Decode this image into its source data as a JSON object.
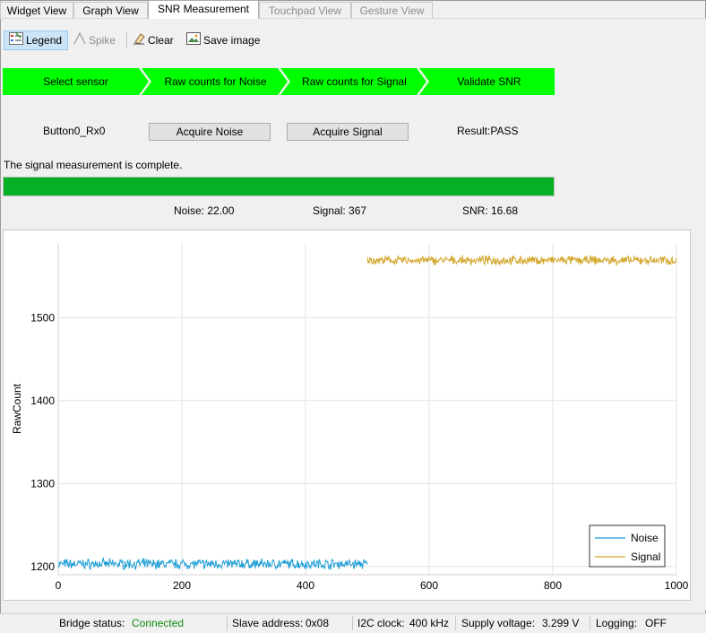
{
  "tabs": [
    {
      "label": "Widget View",
      "state": "normal"
    },
    {
      "label": "Graph View",
      "state": "normal"
    },
    {
      "label": "SNR Measurement",
      "state": "active"
    },
    {
      "label": "Touchpad View",
      "state": "disabled"
    },
    {
      "label": "Gesture View",
      "state": "disabled"
    }
  ],
  "toolbar": {
    "legend": "Legend",
    "spike": "Spike",
    "clear": "Clear",
    "save_image": "Save image"
  },
  "steps": [
    "Select sensor",
    "Raw counts for Noise",
    "Raw counts for Signal",
    "Validate SNR"
  ],
  "step_color": "#00ff00",
  "sensor": "Button0_Rx0",
  "buttons": {
    "acquire_noise": "Acquire Noise",
    "acquire_signal": "Acquire Signal"
  },
  "result": "Result:PASS",
  "status_message": "The signal measurement is complete.",
  "progress_percent": 100,
  "metrics": {
    "noise": "Noise:  22.00",
    "signal": "Signal:  367",
    "snr": "SNR:  16.68"
  },
  "chart_data": {
    "type": "line",
    "ylabel": "RawCount",
    "xlabel": "",
    "xlim": [
      0,
      1000
    ],
    "ylim": [
      1190,
      1590
    ],
    "x_ticks": [
      "0",
      "200",
      "400",
      "600",
      "800",
      "1000"
    ],
    "y_ticks": [
      "1200",
      "1300",
      "1400",
      "1500"
    ],
    "x_tick_values": [
      0,
      200,
      400,
      600,
      800,
      1000
    ],
    "y_tick_values": [
      1200,
      1300,
      1400,
      1500
    ],
    "grid": true,
    "legend_position": "bottom-right",
    "series": [
      {
        "name": "Noise",
        "color": "#1f9fd6",
        "x_range": [
          0,
          500
        ],
        "mean": 1203,
        "spread": 9
      },
      {
        "name": "Signal",
        "color": "#d4a72c",
        "x_range": [
          500,
          1000
        ],
        "mean": 1569,
        "spread": 8
      }
    ]
  },
  "statusbar": {
    "bridge_label": "Bridge status:",
    "bridge_value": "Connected",
    "slave_label": "Slave address:",
    "slave_value": "0x08",
    "i2c_label": "I2C clock:",
    "i2c_value": "400 kHz",
    "supply_label": "Supply voltage:",
    "supply_value": "3.299 V",
    "logging_label": "Logging:",
    "logging_value": "OFF"
  }
}
